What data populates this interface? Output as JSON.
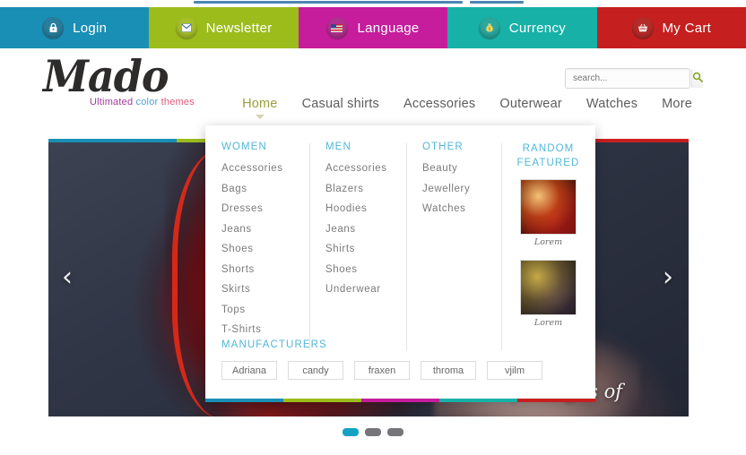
{
  "brand": {
    "logo_text": "Mado",
    "tagline_part1": "Ultimated ",
    "tagline_part2": "color ",
    "tagline_part3": "themes",
    "colors": {
      "login": "#1a8fb5",
      "newsletter": "#9cbc1c",
      "language": "#c61d9c",
      "currency": "#17b1a8",
      "cart": "#c5201f",
      "accent_active_nav": "#9aa03c",
      "menu_heading": "#52b7d8",
      "dot_active": "#12a3c4"
    }
  },
  "topbar": {
    "items": [
      {
        "label": "Login",
        "icon": "lock-icon",
        "color": "#1a8fb5"
      },
      {
        "label": "Newsletter",
        "icon": "envelope-icon",
        "color": "#9cbc1c"
      },
      {
        "label": "Language",
        "icon": "flag-icon",
        "color": "#c61d9c"
      },
      {
        "label": "Currency",
        "icon": "money-bag-icon",
        "color": "#17b1a8"
      },
      {
        "label": "My Cart",
        "icon": "basket-icon",
        "color": "#c5201f"
      }
    ]
  },
  "search": {
    "placeholder": "search...",
    "value": "",
    "button_icon": "search-icon"
  },
  "nav": {
    "items": [
      {
        "label": "Home",
        "active": true
      },
      {
        "label": "Casual shirts",
        "active": false
      },
      {
        "label": "Accessories",
        "active": false
      },
      {
        "label": "Outerwear",
        "active": false
      },
      {
        "label": "Watches",
        "active": false
      },
      {
        "label": "More",
        "active": false
      }
    ]
  },
  "megamenu": {
    "women": {
      "title": "WOMEN",
      "links": [
        "Accessories",
        "Bags",
        "Dresses",
        "Jeans",
        "Shoes",
        "Shorts",
        "Skirts",
        "Tops",
        "T-Shirts"
      ]
    },
    "men": {
      "title": "MEN",
      "links": [
        "Accessories",
        "Blazers",
        "Hoodies",
        "Jeans",
        "Shirts",
        "Shoes",
        "Underwear"
      ]
    },
    "other": {
      "title": "OTHER",
      "links": [
        "Beauty",
        "Jewellery",
        "Watches"
      ]
    },
    "random_featured": {
      "title": "RANDOM FEATURED",
      "items": [
        {
          "caption": "Lorem"
        },
        {
          "caption": "Lorem"
        }
      ]
    },
    "manufacturers": {
      "title": "MANUFACTURERS",
      "items": [
        "Adriana",
        "candy",
        "fraxen",
        "throma",
        "vjilm"
      ]
    }
  },
  "slider": {
    "caption": "passages of",
    "prev_arrow": "‹",
    "next_arrow": "›",
    "dots": [
      {
        "active": true
      },
      {
        "active": false
      },
      {
        "active": false
      }
    ]
  }
}
